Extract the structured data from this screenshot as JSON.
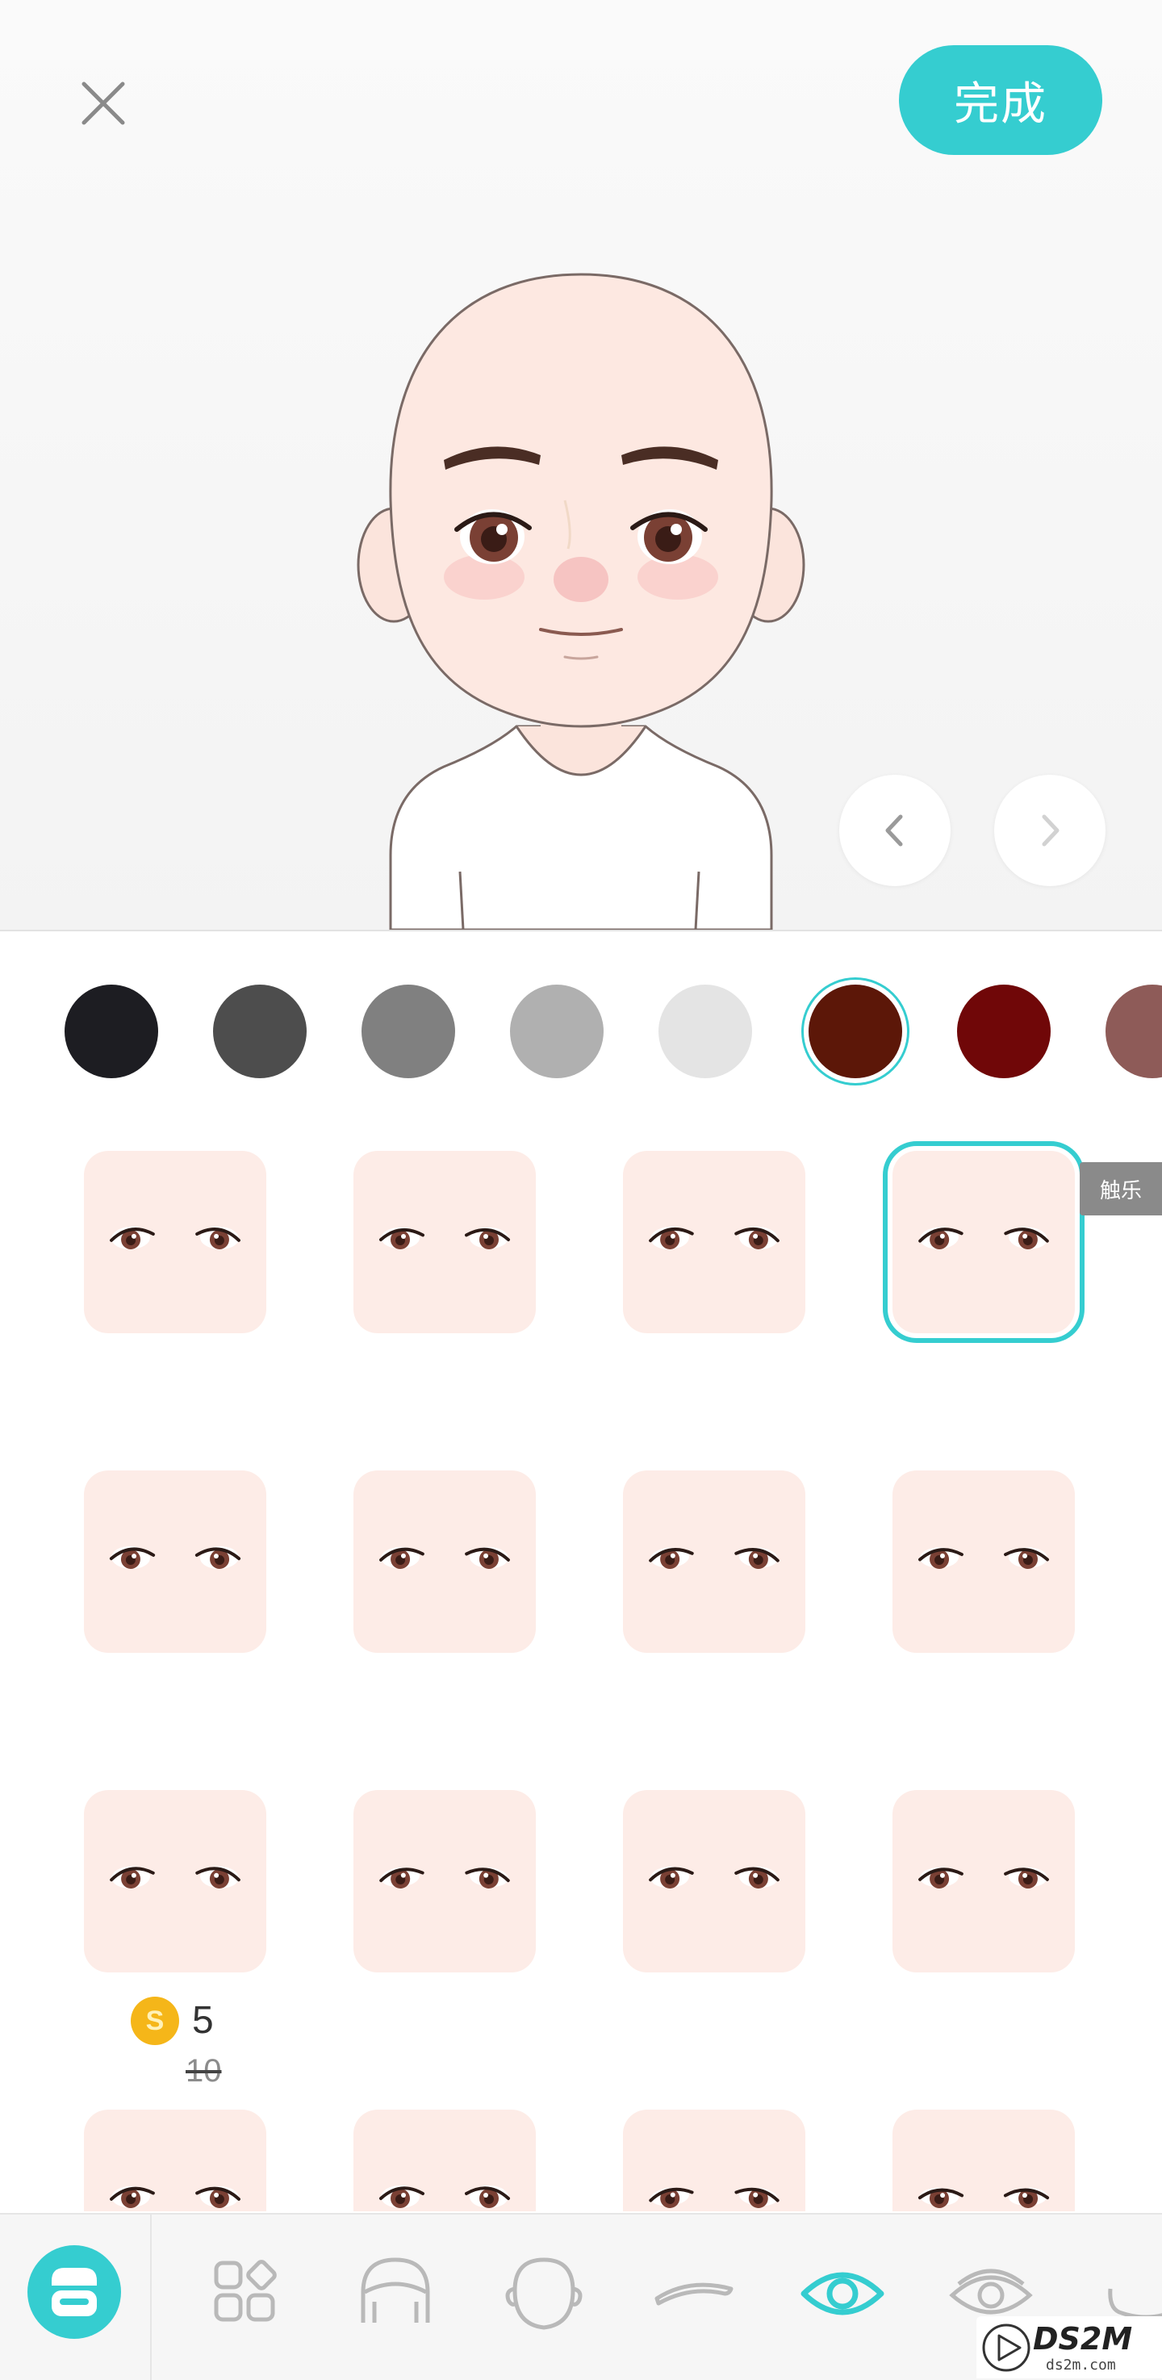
{
  "header": {
    "done_label": "完成"
  },
  "colors": {
    "accent": "#35cdd0",
    "swatches": [
      "#1d1d22",
      "#4d4d4d",
      "#808080",
      "#b0b0b0",
      "#e4e4e4",
      "#5c1708",
      "#700708",
      "#8e5b58"
    ],
    "selected_swatch_index": 5
  },
  "eye_styles": {
    "selected_index": 3,
    "count_visible": 16
  },
  "price": {
    "current": "5",
    "original": "10",
    "coin_glyph": "S"
  },
  "watermark": {
    "tag": "触乐",
    "logo": "DS2M",
    "logo_sub": "ds2m.com"
  },
  "toolbar": {
    "items": [
      "avatar-home-icon",
      "apps-grid-icon",
      "hair-icon",
      "face-shape-icon",
      "eyebrow-icon",
      "eye-icon",
      "eyelid-icon",
      "mouth-icon"
    ],
    "active_item": "eye-icon"
  }
}
